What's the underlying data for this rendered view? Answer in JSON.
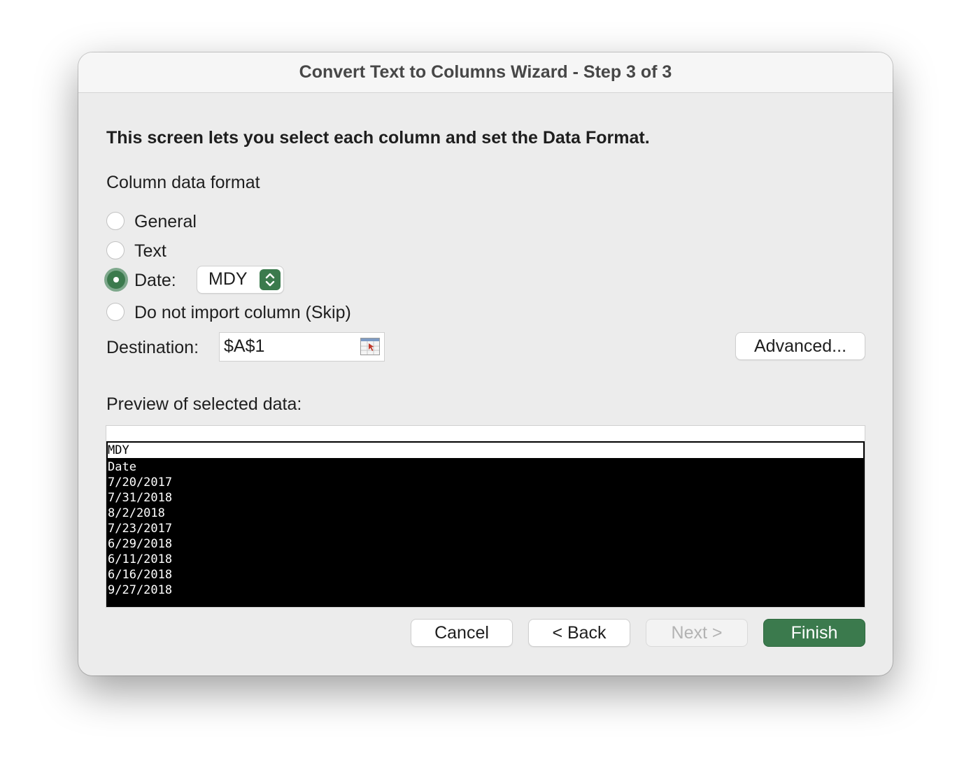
{
  "window": {
    "title": "Convert Text to Columns Wizard - Step 3 of 3"
  },
  "intro": "This screen lets you select each column and set the Data Format.",
  "format_group": {
    "label": "Column data format",
    "options": [
      {
        "label": "General",
        "selected": false
      },
      {
        "label": "Text",
        "selected": false
      },
      {
        "label": "Date:",
        "selected": true
      },
      {
        "label": "Do not import column (Skip)",
        "selected": false
      }
    ],
    "date_format": {
      "value": "MDY"
    }
  },
  "destination": {
    "label": "Destination:",
    "value": "$A$1",
    "picker_icon": "range-picker-icon"
  },
  "advanced_button": "Advanced...",
  "preview": {
    "label": "Preview of selected data:",
    "column_header": "MDY",
    "rows": [
      "Date",
      "7/20/2017",
      "7/31/2018",
      "8/2/2018",
      "7/23/2017",
      "6/29/2018",
      "6/11/2018",
      "6/16/2018",
      "9/27/2018"
    ]
  },
  "buttons": {
    "cancel": "Cancel",
    "back": "< Back",
    "next": "Next >",
    "finish": "Finish"
  },
  "colors": {
    "accent": "#3b7a4d",
    "window_bg": "#ececec",
    "disabled_text": "#b3b3b3"
  }
}
